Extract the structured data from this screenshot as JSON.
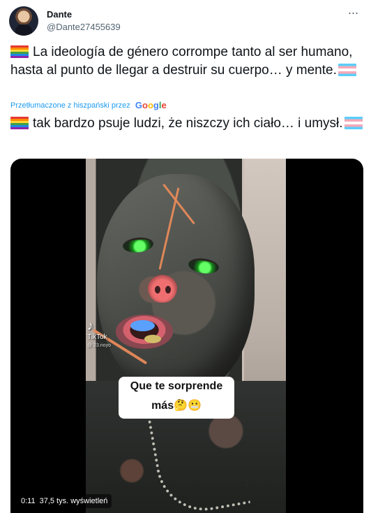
{
  "user": {
    "display_name": "Dante",
    "handle": "@Dante27455639"
  },
  "menu": {
    "icon": "more-icon",
    "label": "···"
  },
  "tweet": {
    "original_text": "La ideología de género corrompe tanto al ser humano, hasta al punto de llegar a destruir su cuerpo… y mente.",
    "translation_note": "Przetłumaczone z hiszpański przez",
    "translated_text": "tak bardzo psuje ludzi, że niszczy ich ciało… i umysł."
  },
  "translation": {
    "service_logo": "Google"
  },
  "media": {
    "tiktok_label": "TikTok",
    "tiktok_user": "@ 23.noyo",
    "caption_text": "Que te sorprende más🤔😬",
    "time": "0:11",
    "views": "37,5 tys. wyświetleń"
  },
  "colors": {
    "text": "#0f1419",
    "secondary_text": "#536471",
    "link_blue": "#1d9bf0",
    "media_background": "#000000"
  }
}
